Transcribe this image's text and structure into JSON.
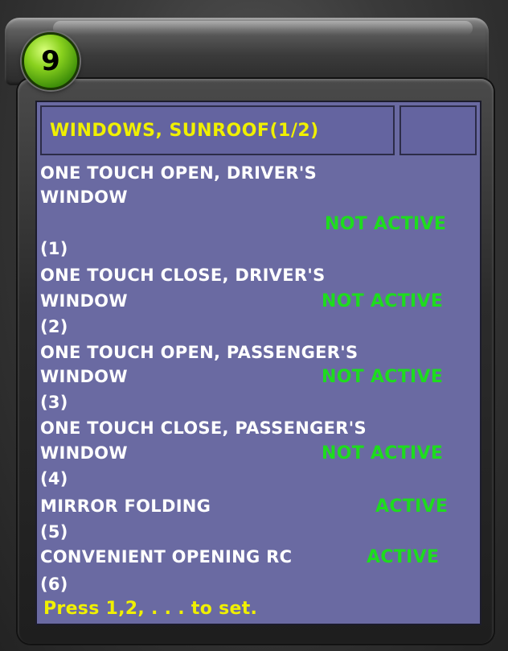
{
  "channel": {
    "number": "9"
  },
  "screen": {
    "title": "WINDOWS, SUNROOF(1/2)",
    "items": [
      {
        "label_line1": "ONE TOUCH OPEN, DRIVER'S",
        "label_line2": "WINDOW",
        "status": "NOT ACTIVE",
        "key": "(1)"
      },
      {
        "label_line1": "ONE TOUCH CLOSE, DRIVER'S",
        "label_line2": "WINDOW",
        "status": "NOT ACTIVE",
        "key": "(2)"
      },
      {
        "label_line1": "ONE TOUCH OPEN, PASSENGER'S",
        "label_line2": "WINDOW",
        "status": "NOT ACTIVE",
        "key": "(3)"
      },
      {
        "label_line1": "ONE TOUCH CLOSE, PASSENGER'S",
        "label_line2": "WINDOW",
        "status": "NOT ACTIVE",
        "key": "(4)"
      },
      {
        "label_line1": "MIRROR FOLDING",
        "status": "ACTIVE",
        "key": "(5)"
      },
      {
        "label_line1": "CONVENIENT OPENING RC",
        "status": "ACTIVE",
        "key": "(6)"
      }
    ],
    "hint": "Press 1,2, . . . to set."
  },
  "colors": {
    "screen_bg": "#6a6aa2",
    "title_text": "#f0f000",
    "status_text": "#1edc1e",
    "body_text": "#ffffff",
    "badge": "#6cc21a"
  }
}
